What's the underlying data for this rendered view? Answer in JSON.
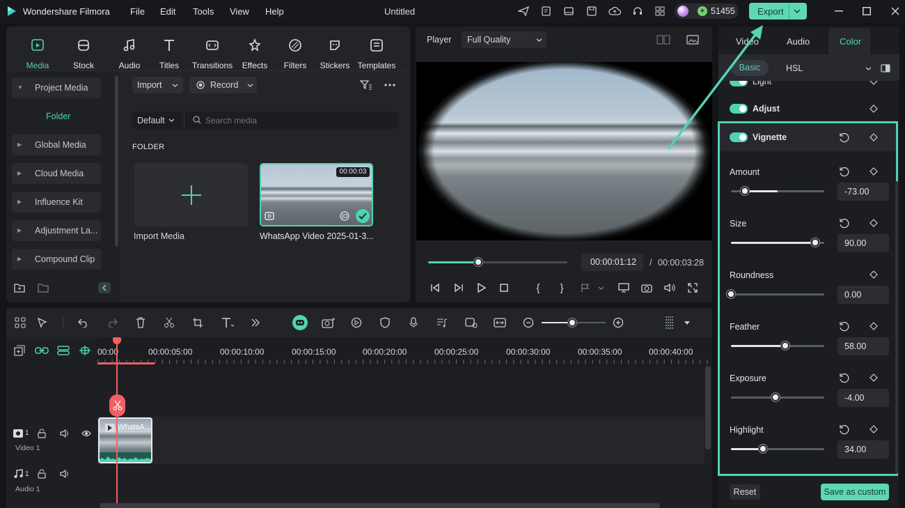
{
  "app": {
    "title": "Wondershare Filmora",
    "project_title": "Untitled",
    "credits": "51455",
    "export_label": "Export"
  },
  "menu": [
    "File",
    "Edit",
    "Tools",
    "View",
    "Help"
  ],
  "media_tabs": [
    {
      "label": "Media",
      "icon": "media-icon"
    },
    {
      "label": "Stock Media",
      "icon": "stock-media-icon"
    },
    {
      "label": "Audio",
      "icon": "audio-icon"
    },
    {
      "label": "Titles",
      "icon": "titles-icon"
    },
    {
      "label": "Transitions",
      "icon": "transitions-icon"
    },
    {
      "label": "Effects",
      "icon": "effects-icon"
    },
    {
      "label": "Filters",
      "icon": "filters-icon"
    },
    {
      "label": "Stickers",
      "icon": "stickers-icon"
    },
    {
      "label": "Templates",
      "icon": "templates-icon"
    }
  ],
  "sidebar": {
    "project_media": "Project Media",
    "folder": "Folder",
    "items": [
      "Global Media",
      "Cloud Media",
      "Influence Kit",
      "Adjustment La...",
      "Compound Clip"
    ]
  },
  "media_browser": {
    "import_label": "Import",
    "record_label": "Record",
    "sort_label": "Default",
    "search_placeholder": "Search media",
    "folder_heading": "FOLDER",
    "import_media_label": "Import Media",
    "clip_name": "WhatsApp Video 2025-01-3...",
    "clip_duration": "00:00:03"
  },
  "player": {
    "label": "Player",
    "quality": "Full Quality",
    "current_time": "00:00:01:12",
    "separator": "/",
    "total_time": "00:00:03:28",
    "progress": 0.36
  },
  "timeline": {
    "ruler": [
      "00:00",
      "00:00:05:00",
      "00:00:10:00",
      "00:00:15:00",
      "00:00:20:00",
      "00:00:25:00",
      "00:00:30:00",
      "00:00:35:00",
      "00:00:40:00"
    ],
    "video_track": "Video 1",
    "video_track_num": "1",
    "audio_track": "Audio 1",
    "audio_track_num": "1",
    "clip_label": "WhatsA..."
  },
  "properties": {
    "tabs": [
      "Video",
      "Audio",
      "Color"
    ],
    "active_tab": "Color",
    "subtabs": [
      "Basic",
      "HSL"
    ],
    "sections": {
      "light": "Light",
      "adjust": "Adjust",
      "vignette": "Vignette"
    },
    "params": [
      {
        "label": "Amount",
        "value": "-73.00",
        "level": 0.15,
        "range": "-100..100"
      },
      {
        "label": "Size",
        "value": "90.00",
        "level": 0.9,
        "range": "0..100"
      },
      {
        "label": "Roundness",
        "value": "0.00",
        "level": 0.0,
        "range": "0..100"
      },
      {
        "label": "Feather",
        "value": "58.00",
        "level": 0.58,
        "range": "0..100"
      },
      {
        "label": "Exposure",
        "value": "-4.00",
        "level": 0.48,
        "range": "-100..100"
      },
      {
        "label": "Highlight",
        "value": "34.00",
        "level": 0.34,
        "range": "0..100"
      }
    ],
    "reset_label": "Reset",
    "save_label": "Save as custom"
  },
  "colors": {
    "accent": "#4fd3b3",
    "highlight_box": "#4fd3b3",
    "playhead": "#f35f63",
    "export_bg": "#5ed8b4"
  }
}
